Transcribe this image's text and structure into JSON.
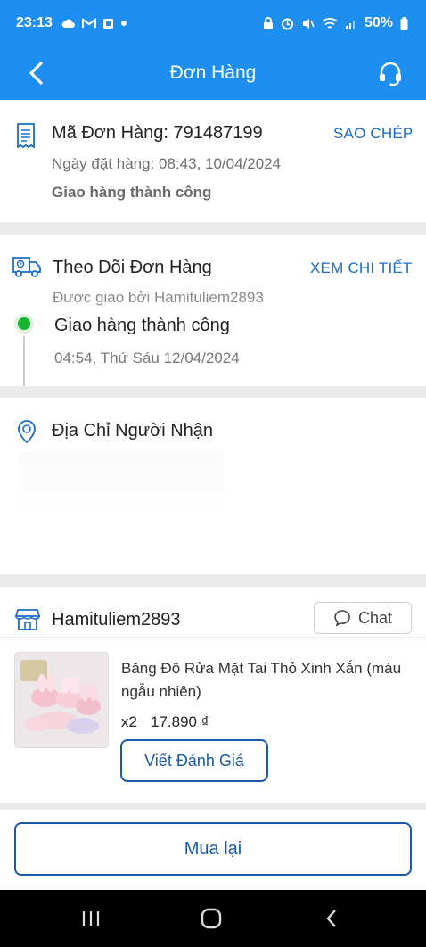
{
  "status_bar": {
    "time": "23:13",
    "battery": "50%",
    "icons": [
      "cloud-icon",
      "gmail-icon",
      "app-icon",
      "dot-icon",
      "lock-icon",
      "alarm-icon",
      "mute-icon",
      "wifi-icon",
      "signal-icon",
      "battery-icon"
    ]
  },
  "header": {
    "title": "Đơn Hàng",
    "back_icon": "back-arrow-icon",
    "support_icon": "headset-icon"
  },
  "order": {
    "code_label": "Mã Đơn Hàng: 791487199",
    "copy_label": "SAO CHÉP",
    "date_label": "Ngày đặt hàng: 08:43, 10/04/2024",
    "status_label": "Giao hàng thành công"
  },
  "tracking": {
    "title": "Theo Dõi Đơn Hàng",
    "detail_label": "XEM CHI TIẾT",
    "delivered_by": "Được giao bởi Hamituliem2893",
    "event_title": "Giao hàng thành công",
    "event_time": "04:54, Thứ Sáu 12/04/2024"
  },
  "address": {
    "title": "Địa Chỉ Người Nhận"
  },
  "shop": {
    "name": "Hamituliem2893",
    "chat_label": "Chat"
  },
  "product": {
    "name": "Băng Đô Rửa Mặt Tai Thỏ Xinh Xắn (màu ngẫu nhiên)",
    "quantity": "x2",
    "price": "17.890 ₫",
    "review_label": "Viết Đánh Giá"
  },
  "actions": {
    "rebuy_label": "Mua lại"
  },
  "colors": {
    "primary": "#1e8ff0",
    "link": "#1a6cc8",
    "button_border": "#1a5aa8",
    "success": "#15b52f"
  }
}
